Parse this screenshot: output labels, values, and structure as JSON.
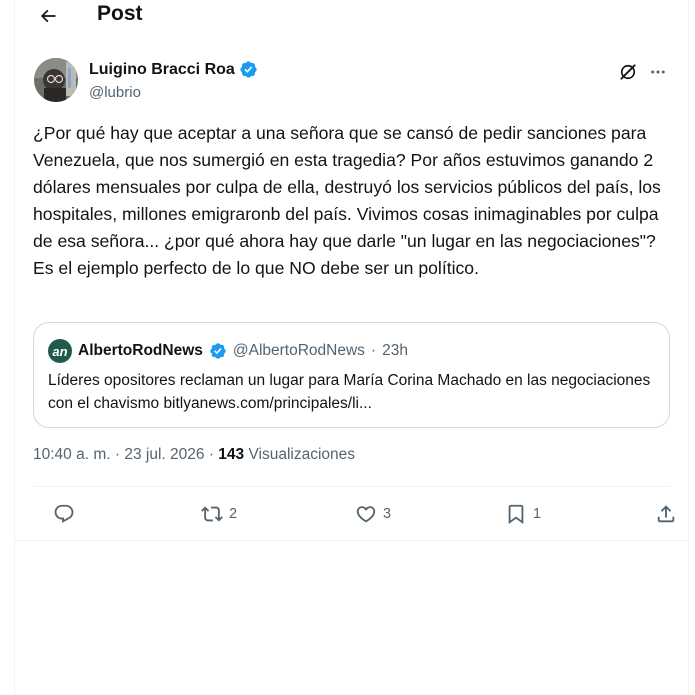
{
  "header": {
    "title": "Post"
  },
  "author": {
    "name": "Luigino Bracci Roa",
    "handle": "@lubrio"
  },
  "tweet": {
    "text": "¿Por qué hay que aceptar a una señora que se cansó de pedir sanciones para Venezuela, que nos sumergió en esta tragedia? Por años estuvimos ganando 2 dólares mensuales por culpa de ella, destruyó los servicios públicos del país, los hospitales, millones emigraronb del país. Vivimos cosas inimaginables por culpa de esa señora... ¿por qué ahora hay que darle \"un lugar en las negociaciones\"? Es el ejemplo perfecto de lo que NO debe ser un político."
  },
  "quote": {
    "avatar_letter": "an",
    "name": "AlbertoRodNews",
    "handle": "@AlbertoRodNews",
    "separator": "·",
    "time": "23h",
    "text": "Líderes opositores reclaman un lugar para María Corina Machado en las negociaciones con el chavismo bitlyanews.com/principales/li..."
  },
  "meta": {
    "time": "10:40 a. m.",
    "separator": "·",
    "date": "23 jul. 2026",
    "views_count": "143",
    "views_label": "Visualizaciones"
  },
  "actions": {
    "reply_count": "",
    "retweet_count": "2",
    "like_count": "3",
    "bookmark_count": "1"
  },
  "icons": {
    "back": "arrow-left-icon",
    "verified": "verified-badge-icon",
    "grok": "grok-icon",
    "more": "more-icon",
    "reply": "reply-icon",
    "retweet": "retweet-icon",
    "like": "heart-icon",
    "bookmark": "bookmark-icon",
    "share": "share-icon"
  },
  "colors": {
    "verified": "#1d9bf0",
    "text_primary": "#0f1419",
    "text_secondary": "#536471",
    "border": "#cfd9de",
    "divider": "#eff3f4"
  }
}
